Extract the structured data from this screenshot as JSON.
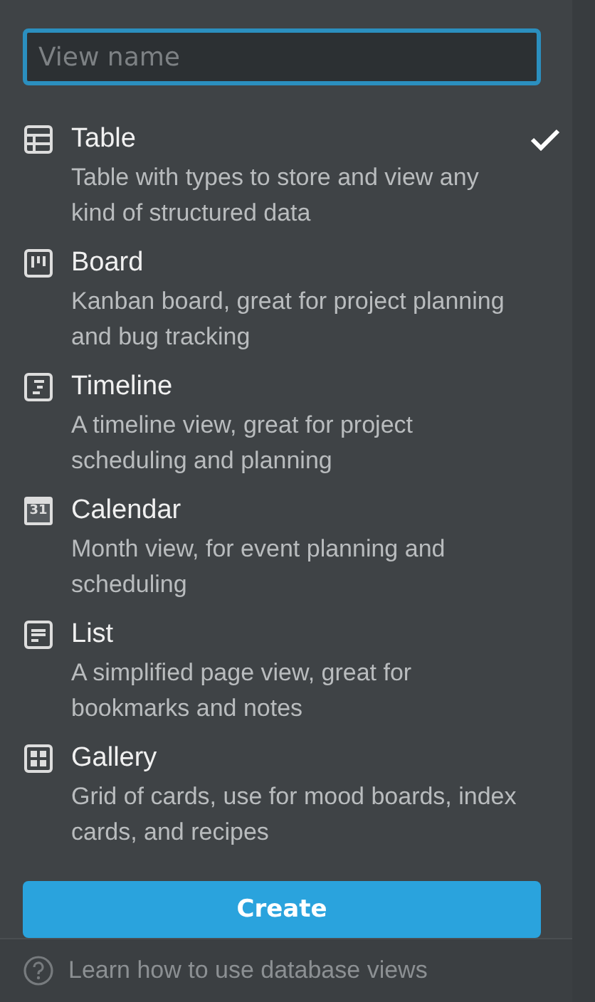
{
  "search": {
    "placeholder": "View name"
  },
  "views": [
    {
      "kind": "table",
      "title": "Table",
      "description": "Table with types to store and view any kind of structured data",
      "selected": true
    },
    {
      "kind": "board",
      "title": "Board",
      "description": "Kanban board, great for project planning and bug tracking",
      "selected": false
    },
    {
      "kind": "timeline",
      "title": "Timeline",
      "description": "A timeline view, great for project scheduling and planning",
      "selected": false
    },
    {
      "kind": "calendar",
      "title": "Calendar",
      "description": "Month view, for event planning and scheduling",
      "selected": false,
      "icon_text": "31"
    },
    {
      "kind": "list",
      "title": "List",
      "description": "A simplified page view, great for bookmarks and notes",
      "selected": false
    },
    {
      "kind": "gallery",
      "title": "Gallery",
      "description": "Grid of cards, use for mood boards, index cards, and recipes",
      "selected": false
    }
  ],
  "create_button": "Create",
  "footer": {
    "link": "Learn how to use database views"
  }
}
